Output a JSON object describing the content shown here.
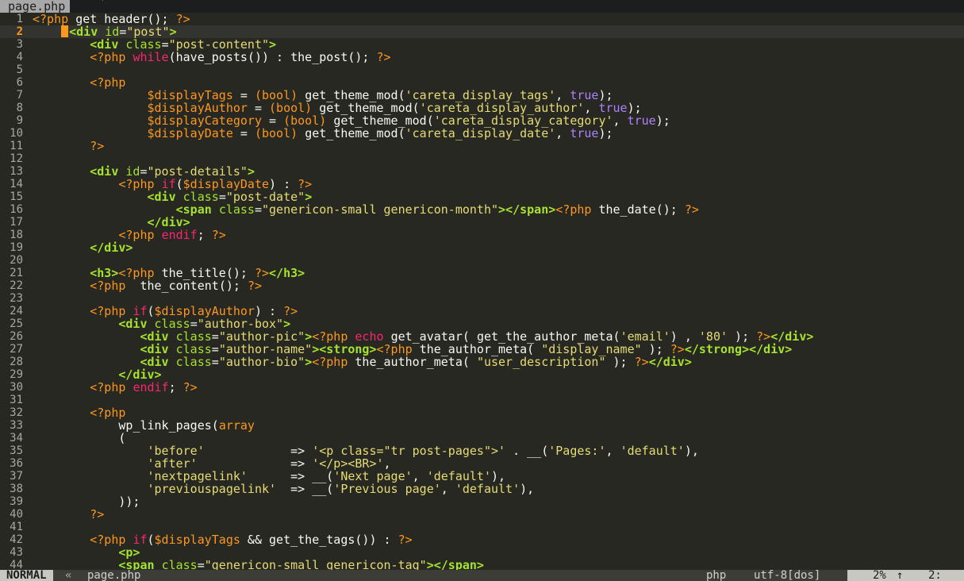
{
  "tabline": {
    "active_tab": "page.php",
    "modified_flag": "´"
  },
  "cursor_line": 2,
  "lines": [
    {
      "n": "1",
      "t": [
        [
          "php",
          "<?php "
        ],
        [
          "fn",
          "get_header"
        ],
        [
          "pun",
          "(); "
        ],
        [
          "php",
          "?>"
        ]
      ]
    },
    {
      "n": "2",
      "cursor": true,
      "t": [
        [
          "pl",
          "    "
        ],
        [
          "tag",
          "<div "
        ],
        [
          "at",
          "id"
        ],
        [
          "pun",
          "="
        ],
        [
          "str",
          "\"post\""
        ],
        [
          "tag",
          ">"
        ]
      ]
    },
    {
      "n": "3",
      "t": [
        [
          "pl",
          "        "
        ],
        [
          "tag",
          "<div "
        ],
        [
          "at",
          "class"
        ],
        [
          "pun",
          "="
        ],
        [
          "str",
          "\"post-content\""
        ],
        [
          "tag",
          ">"
        ]
      ]
    },
    {
      "n": "4",
      "t": [
        [
          "pl",
          "        "
        ],
        [
          "php",
          "<?php "
        ],
        [
          "kw",
          "while"
        ],
        [
          "pun",
          "("
        ],
        [
          "fn",
          "have_posts"
        ],
        [
          "pun",
          "()) : "
        ],
        [
          "fn",
          "the_post"
        ],
        [
          "pun",
          "(); "
        ],
        [
          "php",
          "?>"
        ]
      ]
    },
    {
      "n": "5",
      "t": []
    },
    {
      "n": "6",
      "t": [
        [
          "pl",
          "        "
        ],
        [
          "php",
          "<?php"
        ]
      ]
    },
    {
      "n": "7",
      "t": [
        [
          "pl",
          "                "
        ],
        [
          "var",
          "$displayTags"
        ],
        [
          "pun",
          " = "
        ],
        [
          "ty",
          "(bool)"
        ],
        [
          "pl",
          " "
        ],
        [
          "fn",
          "get_theme_mod"
        ],
        [
          "pun",
          "("
        ],
        [
          "str",
          "'careta_display_tags'"
        ],
        [
          "pun",
          ", "
        ],
        [
          "bool",
          "true"
        ],
        [
          "pun",
          ");"
        ]
      ]
    },
    {
      "n": "8",
      "t": [
        [
          "pl",
          "                "
        ],
        [
          "var",
          "$displayAuthor"
        ],
        [
          "pun",
          " = "
        ],
        [
          "ty",
          "(bool)"
        ],
        [
          "pl",
          " "
        ],
        [
          "fn",
          "get_theme_mod"
        ],
        [
          "pun",
          "("
        ],
        [
          "str",
          "'careta_display_author'"
        ],
        [
          "pun",
          ", "
        ],
        [
          "bool",
          "true"
        ],
        [
          "pun",
          ");"
        ]
      ]
    },
    {
      "n": "9",
      "t": [
        [
          "pl",
          "                "
        ],
        [
          "var",
          "$displayCategory"
        ],
        [
          "pun",
          " = "
        ],
        [
          "ty",
          "(bool)"
        ],
        [
          "pl",
          " "
        ],
        [
          "fn",
          "get_theme_mod"
        ],
        [
          "pun",
          "("
        ],
        [
          "str",
          "'careta_display_category'"
        ],
        [
          "pun",
          ", "
        ],
        [
          "bool",
          "true"
        ],
        [
          "pun",
          ");"
        ]
      ]
    },
    {
      "n": "10",
      "t": [
        [
          "pl",
          "                "
        ],
        [
          "var",
          "$displayDate"
        ],
        [
          "pun",
          " = "
        ],
        [
          "ty",
          "(bool)"
        ],
        [
          "pl",
          " "
        ],
        [
          "fn",
          "get_theme_mod"
        ],
        [
          "pun",
          "("
        ],
        [
          "str",
          "'careta_display_date'"
        ],
        [
          "pun",
          ", "
        ],
        [
          "bool",
          "true"
        ],
        [
          "pun",
          ");"
        ]
      ]
    },
    {
      "n": "11",
      "t": [
        [
          "pl",
          "        "
        ],
        [
          "php",
          "?>"
        ]
      ]
    },
    {
      "n": "12",
      "t": []
    },
    {
      "n": "13",
      "t": [
        [
          "pl",
          "        "
        ],
        [
          "tag",
          "<div "
        ],
        [
          "at",
          "id"
        ],
        [
          "pun",
          "="
        ],
        [
          "str",
          "\"post-details\""
        ],
        [
          "tag",
          ">"
        ]
      ]
    },
    {
      "n": "14",
      "t": [
        [
          "pl",
          "            "
        ],
        [
          "php",
          "<?php "
        ],
        [
          "kw",
          "if"
        ],
        [
          "pun",
          "("
        ],
        [
          "var",
          "$displayDate"
        ],
        [
          "pun",
          ") : "
        ],
        [
          "php",
          "?>"
        ]
      ]
    },
    {
      "n": "15",
      "t": [
        [
          "pl",
          "                "
        ],
        [
          "tag",
          "<div "
        ],
        [
          "at",
          "class"
        ],
        [
          "pun",
          "="
        ],
        [
          "str",
          "\"post-date\""
        ],
        [
          "tag",
          ">"
        ]
      ]
    },
    {
      "n": "16",
      "t": [
        [
          "pl",
          "                    "
        ],
        [
          "tag",
          "<span "
        ],
        [
          "at",
          "class"
        ],
        [
          "pun",
          "="
        ],
        [
          "str",
          "\"genericon-small genericon-month\""
        ],
        [
          "tag",
          ">"
        ],
        [
          "tag",
          "</span>"
        ],
        [
          "php",
          "<?php "
        ],
        [
          "fn",
          "the_date"
        ],
        [
          "pun",
          "(); "
        ],
        [
          "php",
          "?>"
        ]
      ]
    },
    {
      "n": "17",
      "t": [
        [
          "pl",
          "                "
        ],
        [
          "tag",
          "</div>"
        ]
      ]
    },
    {
      "n": "18",
      "t": [
        [
          "pl",
          "            "
        ],
        [
          "php",
          "<?php "
        ],
        [
          "kw",
          "endif"
        ],
        [
          "pun",
          "; "
        ],
        [
          "php",
          "?>"
        ]
      ]
    },
    {
      "n": "19",
      "t": [
        [
          "pl",
          "        "
        ],
        [
          "tag",
          "</div>"
        ]
      ]
    },
    {
      "n": "20",
      "t": []
    },
    {
      "n": "21",
      "t": [
        [
          "pl",
          "        "
        ],
        [
          "tag",
          "<h3>"
        ],
        [
          "php",
          "<?php "
        ],
        [
          "fn",
          "the_title"
        ],
        [
          "pun",
          "(); "
        ],
        [
          "php",
          "?>"
        ],
        [
          "tag",
          "</h3>"
        ]
      ]
    },
    {
      "n": "22",
      "t": [
        [
          "pl",
          "        "
        ],
        [
          "php",
          "<?php "
        ],
        [
          "pl",
          " "
        ],
        [
          "fn",
          "the_content"
        ],
        [
          "pun",
          "(); "
        ],
        [
          "php",
          "?>"
        ]
      ]
    },
    {
      "n": "23",
      "t": []
    },
    {
      "n": "24",
      "t": [
        [
          "pl",
          "        "
        ],
        [
          "php",
          "<?php "
        ],
        [
          "kw",
          "if"
        ],
        [
          "pun",
          "("
        ],
        [
          "var",
          "$displayAuthor"
        ],
        [
          "pun",
          ") : "
        ],
        [
          "php",
          "?>"
        ]
      ]
    },
    {
      "n": "25",
      "t": [
        [
          "pl",
          "            "
        ],
        [
          "tag",
          "<div "
        ],
        [
          "at",
          "class"
        ],
        [
          "pun",
          "="
        ],
        [
          "str",
          "\"author-box\""
        ],
        [
          "tag",
          ">"
        ]
      ]
    },
    {
      "n": "26",
      "t": [
        [
          "pl",
          "               "
        ],
        [
          "tag",
          "<div "
        ],
        [
          "at",
          "class"
        ],
        [
          "pun",
          "="
        ],
        [
          "str",
          "\"author-pic\""
        ],
        [
          "tag",
          ">"
        ],
        [
          "php",
          "<?php "
        ],
        [
          "kw",
          "echo"
        ],
        [
          "pl",
          " "
        ],
        [
          "fn",
          "get_avatar"
        ],
        [
          "pun",
          "( "
        ],
        [
          "fn",
          "get_the_author_meta"
        ],
        [
          "pun",
          "("
        ],
        [
          "str",
          "'email'"
        ],
        [
          "pun",
          ") , "
        ],
        [
          "str",
          "'80'"
        ],
        [
          "pun",
          " ); "
        ],
        [
          "php",
          "?>"
        ],
        [
          "tag",
          "</div>"
        ]
      ]
    },
    {
      "n": "27",
      "t": [
        [
          "pl",
          "               "
        ],
        [
          "tag",
          "<div "
        ],
        [
          "at",
          "class"
        ],
        [
          "pun",
          "="
        ],
        [
          "str",
          "\"author-name\""
        ],
        [
          "tag",
          ">"
        ],
        [
          "tag",
          "<strong>"
        ],
        [
          "php",
          "<?php "
        ],
        [
          "fn",
          "the_author_meta"
        ],
        [
          "pun",
          "( "
        ],
        [
          "str",
          "\"display_name\""
        ],
        [
          "pun",
          " ); "
        ],
        [
          "php",
          "?>"
        ],
        [
          "tag",
          "</strong>"
        ],
        [
          "tag",
          "</div>"
        ]
      ]
    },
    {
      "n": "28",
      "t": [
        [
          "pl",
          "               "
        ],
        [
          "tag",
          "<div "
        ],
        [
          "at",
          "class"
        ],
        [
          "pun",
          "="
        ],
        [
          "str",
          "\"author-bio\""
        ],
        [
          "tag",
          ">"
        ],
        [
          "php",
          "<?php "
        ],
        [
          "fn",
          "the_author_meta"
        ],
        [
          "pun",
          "( "
        ],
        [
          "str",
          "\"user_description\""
        ],
        [
          "pun",
          " ); "
        ],
        [
          "php",
          "?>"
        ],
        [
          "tag",
          "</div>"
        ]
      ]
    },
    {
      "n": "29",
      "t": [
        [
          "pl",
          "            "
        ],
        [
          "tag",
          "</div>"
        ]
      ]
    },
    {
      "n": "30",
      "t": [
        [
          "pl",
          "        "
        ],
        [
          "php",
          "<?php "
        ],
        [
          "kw",
          "endif"
        ],
        [
          "pun",
          "; "
        ],
        [
          "php",
          "?>"
        ]
      ]
    },
    {
      "n": "31",
      "t": []
    },
    {
      "n": "32",
      "t": [
        [
          "pl",
          "        "
        ],
        [
          "php",
          "<?php"
        ]
      ]
    },
    {
      "n": "33",
      "t": [
        [
          "pl",
          "            "
        ],
        [
          "fn",
          "wp_link_pages"
        ],
        [
          "pun",
          "("
        ],
        [
          "ty",
          "array"
        ]
      ]
    },
    {
      "n": "34",
      "t": [
        [
          "pl",
          "            "
        ],
        [
          "pun",
          "("
        ]
      ]
    },
    {
      "n": "35",
      "t": [
        [
          "pl",
          "                "
        ],
        [
          "str",
          "'before'"
        ],
        [
          "pl",
          "            "
        ],
        [
          "pun",
          "=> "
        ],
        [
          "str",
          "'<p class=\"tr post-pages\">'"
        ],
        [
          "pun",
          " . "
        ],
        [
          "fn",
          "__"
        ],
        [
          "pun",
          "("
        ],
        [
          "str",
          "'Pages:'"
        ],
        [
          "pun",
          ", "
        ],
        [
          "str",
          "'default'"
        ],
        [
          "pun",
          "),"
        ]
      ]
    },
    {
      "n": "36",
      "t": [
        [
          "pl",
          "                "
        ],
        [
          "str",
          "'after'"
        ],
        [
          "pl",
          "             "
        ],
        [
          "pun",
          "=> "
        ],
        [
          "str",
          "'</p><BR>'"
        ],
        [
          "pun",
          ","
        ]
      ]
    },
    {
      "n": "37",
      "t": [
        [
          "pl",
          "                "
        ],
        [
          "str",
          "'nextpagelink'"
        ],
        [
          "pl",
          "      "
        ],
        [
          "pun",
          "=> "
        ],
        [
          "fn",
          "__"
        ],
        [
          "pun",
          "("
        ],
        [
          "str",
          "'Next page'"
        ],
        [
          "pun",
          ", "
        ],
        [
          "str",
          "'default'"
        ],
        [
          "pun",
          "),"
        ]
      ]
    },
    {
      "n": "38",
      "t": [
        [
          "pl",
          "                "
        ],
        [
          "str",
          "'previouspagelink'"
        ],
        [
          "pl",
          "  "
        ],
        [
          "pun",
          "=> "
        ],
        [
          "fn",
          "__"
        ],
        [
          "pun",
          "("
        ],
        [
          "str",
          "'Previous page'"
        ],
        [
          "pun",
          ", "
        ],
        [
          "str",
          "'default'"
        ],
        [
          "pun",
          "),"
        ]
      ]
    },
    {
      "n": "39",
      "t": [
        [
          "pl",
          "            "
        ],
        [
          "pun",
          "));"
        ]
      ]
    },
    {
      "n": "40",
      "t": [
        [
          "pl",
          "        "
        ],
        [
          "php",
          "?>"
        ]
      ]
    },
    {
      "n": "41",
      "t": []
    },
    {
      "n": "42",
      "t": [
        [
          "pl",
          "        "
        ],
        [
          "php",
          "<?php "
        ],
        [
          "kw",
          "if"
        ],
        [
          "pun",
          "("
        ],
        [
          "var",
          "$displayTags"
        ],
        [
          "pun",
          " && "
        ],
        [
          "fn",
          "get_the_tags"
        ],
        [
          "pun",
          "()) : "
        ],
        [
          "php",
          "?>"
        ]
      ]
    },
    {
      "n": "43",
      "t": [
        [
          "pl",
          "            "
        ],
        [
          "tag",
          "<p>"
        ]
      ]
    },
    {
      "n": "44",
      "t": [
        [
          "pl",
          "            "
        ],
        [
          "tag",
          "<span "
        ],
        [
          "at",
          "class"
        ],
        [
          "pun",
          "="
        ],
        [
          "str",
          "\"genericon-small genericon-tag\""
        ],
        [
          "tag",
          ">"
        ],
        [
          "tag",
          "</span>"
        ]
      ]
    }
  ],
  "statusline": {
    "mode": "NORMAL",
    "branch_glyph": "«",
    "filename": "page.php",
    "filetype": "php",
    "encoding": "utf-8[dos]",
    "percent": "2%",
    "line_glyph": "↑",
    "column": "2:"
  },
  "colors": {
    "background": "#272822",
    "php_delim": "#fd971f",
    "keyword": "#f92672",
    "string": "#e6db74",
    "html_tag": "#a6e22e",
    "boolean": "#ae81ff"
  }
}
